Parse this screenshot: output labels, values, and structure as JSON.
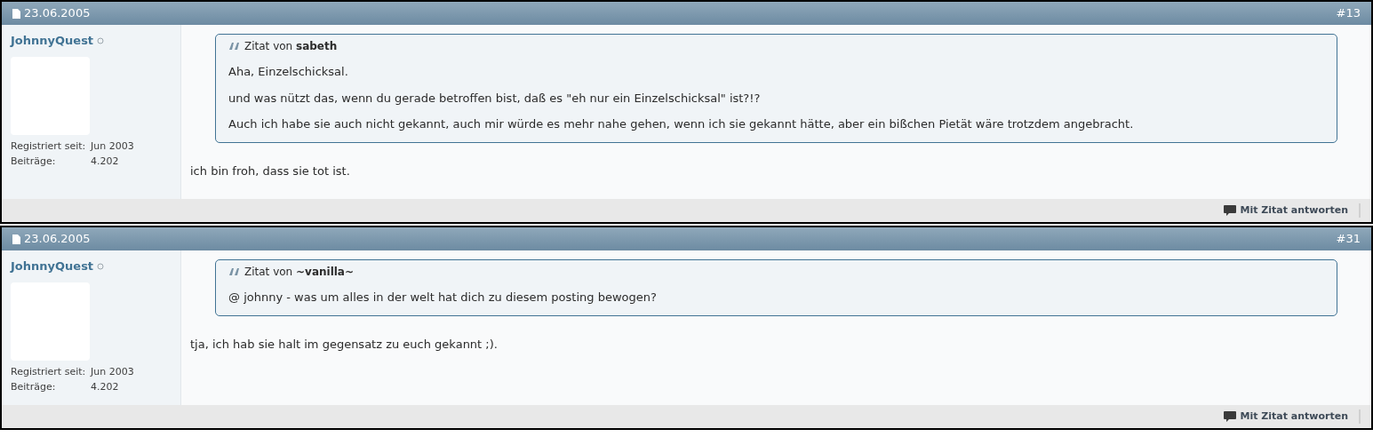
{
  "posts": [
    {
      "date": "23.06.2005",
      "number": "#13",
      "author": "JohnnyQuest",
      "online": false,
      "stats": [
        {
          "label": "Registriert seit:",
          "value": "Jun 2003"
        },
        {
          "label": "Beiträge:",
          "value": "4.202"
        }
      ],
      "quote": {
        "prefix": "Zitat von",
        "author": "sabeth",
        "paragraphs": [
          "Aha, Einzelschicksal.",
          "und was nützt das, wenn du gerade betroffen bist, daß es \"eh nur ein Einzelschicksal\" ist?!?",
          "Auch ich habe sie auch nicht gekannt, auch mir würde es mehr nahe gehen, wenn ich sie gekannt hätte, aber ein bißchen Pietät wäre trotzdem angebracht."
        ]
      },
      "message": "ich bin froh, dass sie tot ist.",
      "reply_button": "Mit Zitat antworten"
    },
    {
      "date": "23.06.2005",
      "number": "#31",
      "author": "JohnnyQuest",
      "online": false,
      "stats": [
        {
          "label": "Registriert seit:",
          "value": "Jun 2003"
        },
        {
          "label": "Beiträge:",
          "value": "4.202"
        }
      ],
      "quote": {
        "prefix": "Zitat von",
        "author": "~vanilla~",
        "paragraphs": [
          "@ johnny - was um alles in der welt hat dich zu diesem posting bewogen?"
        ]
      },
      "message": "tja, ich hab sie halt im gegensatz zu euch gekannt ;).",
      "reply_button": "Mit Zitat antworten"
    }
  ]
}
